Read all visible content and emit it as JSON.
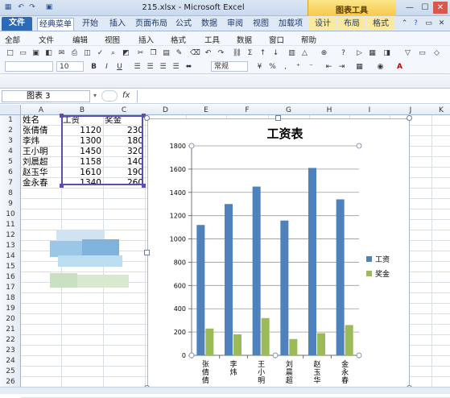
{
  "window": {
    "title": "215.xlsx - Microsoft Excel",
    "chart_tools_label": "图表工具"
  },
  "tabs": [
    "文件",
    "经典菜单",
    "开始",
    "插入",
    "页面布局",
    "公式",
    "数据",
    "审阅",
    "视图",
    "加载项",
    "设计",
    "布局",
    "格式"
  ],
  "menus": [
    "全部",
    "文件",
    "编辑",
    "视图",
    "插入",
    "格式",
    "工具",
    "数据",
    "窗口",
    "帮助"
  ],
  "toolbar": {
    "font_size": "10",
    "style_box": "常规",
    "percent": "%",
    "comma": ","
  },
  "formula": {
    "name_box": "图表 3",
    "fx": "fx",
    "content": ""
  },
  "columns": [
    "A",
    "B",
    "C",
    "D",
    "E",
    "F",
    "G",
    "H",
    "I",
    "J",
    "K"
  ],
  "rows": [
    "1",
    "2",
    "3",
    "4",
    "5",
    "6",
    "7",
    "8",
    "9",
    "10",
    "11",
    "12",
    "13",
    "14",
    "15",
    "16",
    "17",
    "18",
    "19",
    "20",
    "21",
    "22",
    "23",
    "24",
    "25",
    "26"
  ],
  "sheet": {
    "header": [
      "姓名",
      "工资",
      "奖金"
    ],
    "data": [
      [
        "张倩倩",
        "1120",
        "230"
      ],
      [
        "李炜",
        "1300",
        "180"
      ],
      [
        "王小明",
        "1450",
        "320"
      ],
      [
        "刘晨超",
        "1158",
        "140"
      ],
      [
        "赵玉华",
        "1610",
        "190"
      ],
      [
        "金永春",
        "1340",
        "260"
      ]
    ]
  },
  "colors": {
    "series1": "#4f81bd",
    "series2": "#9bbb59",
    "selection": "#5b4fae",
    "file_tab": "#2a6ab7"
  },
  "chart_data": {
    "type": "bar",
    "title": "工资表",
    "categories": [
      "张倩倩",
      "李炜",
      "王小明",
      "刘晨超",
      "赵玉华",
      "金永春"
    ],
    "series": [
      {
        "name": "工资",
        "values": [
          1120,
          1300,
          1450,
          1158,
          1610,
          1340
        ]
      },
      {
        "name": "奖金",
        "values": [
          230,
          180,
          320,
          140,
          190,
          260
        ]
      }
    ],
    "yticks": [
      "0",
      "200",
      "400",
      "600",
      "800",
      "1000",
      "1200",
      "1400",
      "1600",
      "1800"
    ],
    "ylim": [
      0,
      1800
    ],
    "grid": true,
    "legend": "right"
  }
}
